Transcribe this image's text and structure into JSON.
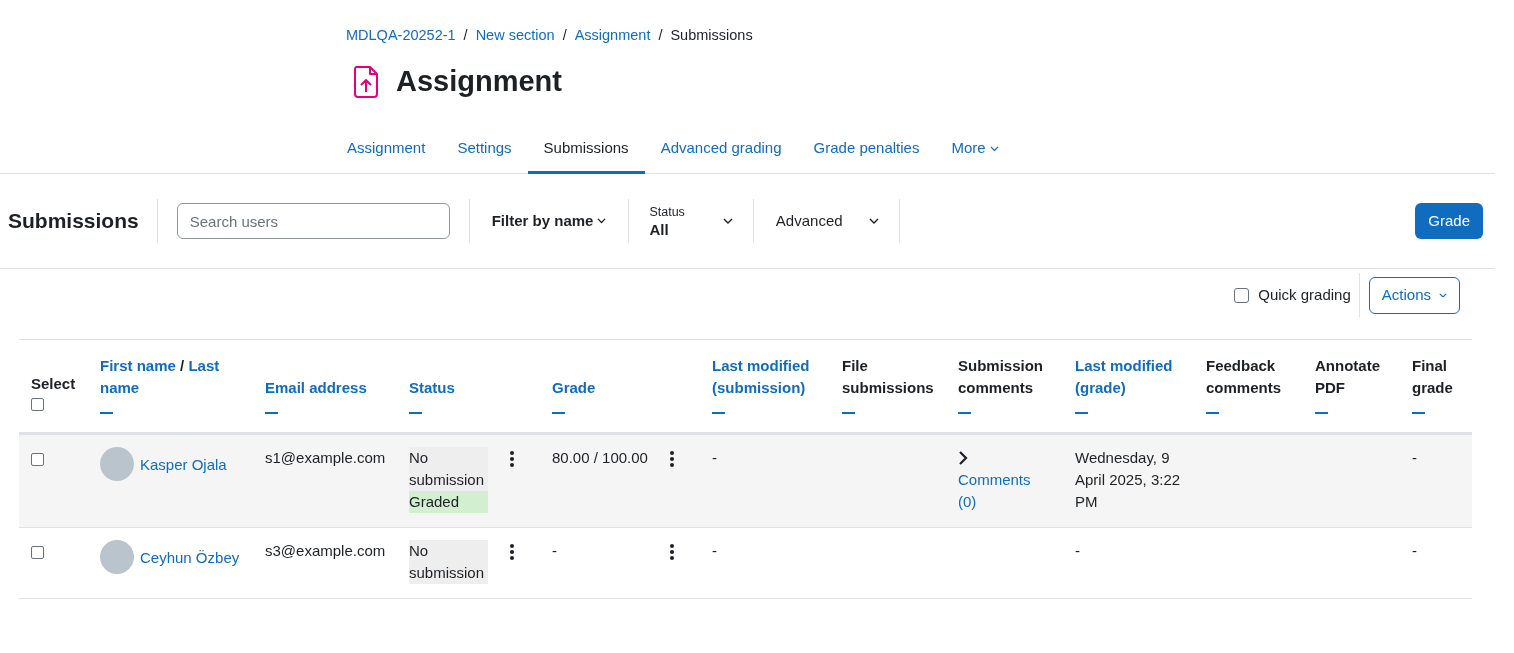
{
  "breadcrumb": [
    {
      "label": "MDLQA-20252-1",
      "link": true
    },
    {
      "separator": "/",
      "label": "New section",
      "link": true
    },
    {
      "separator": "/",
      "label": "Assignment",
      "link": true
    },
    {
      "separator": "/",
      "label": "Submissions",
      "link": false
    }
  ],
  "page_title": "Assignment",
  "tabs": [
    {
      "label": "Assignment",
      "selected": false,
      "kind": "tab"
    },
    {
      "label": "Settings",
      "selected": false,
      "kind": "tab"
    },
    {
      "label": "Submissions",
      "selected": true,
      "kind": "tab"
    },
    {
      "label": "Advanced grading",
      "selected": false,
      "kind": "tab"
    },
    {
      "label": "Grade penalties",
      "selected": false,
      "kind": "tab"
    },
    {
      "label": "More",
      "selected": false,
      "kind": "menu"
    }
  ],
  "toolbar": {
    "title": "Submissions",
    "search": {
      "placeholder": "Search users"
    },
    "filter_by_name": "Filter by name",
    "status": {
      "label": "Status",
      "value": "All"
    },
    "advanced": "Advanced",
    "grade_button": "Grade"
  },
  "quick_grading": {
    "label": "Quick grading",
    "checked": false
  },
  "actions_button": "Actions",
  "table": {
    "columns": [
      {
        "kind": "select",
        "label": "Select",
        "checked": false
      },
      {
        "kind": "name",
        "first": "First name",
        "separator": "/",
        "last": "Last name"
      },
      {
        "kind": "sort",
        "label": "Email address"
      },
      {
        "kind": "sort",
        "label": "Status"
      },
      {
        "kind": "sort",
        "label": "Grade"
      },
      {
        "kind": "sort",
        "label": "Last modified (submission)"
      },
      {
        "kind": "plain",
        "label": "File submissions"
      },
      {
        "kind": "plain",
        "label": "Submission comments"
      },
      {
        "kind": "sort",
        "label": "Last modified (grade)"
      },
      {
        "kind": "plain",
        "label": "Feedback comments"
      },
      {
        "kind": "plain",
        "label": "Annotate PDF"
      },
      {
        "kind": "plain",
        "label": "Final grade"
      }
    ],
    "rows": [
      {
        "selected": false,
        "name": "Kasper Ojala",
        "email": "s1@example.com",
        "status": [
          {
            "text": "No submission",
            "kind": "neutral"
          },
          {
            "text": "Graded",
            "kind": "success"
          }
        ],
        "grade": "80.00 / 100.00",
        "last_modified_submission": "-",
        "comments": {
          "expanded": false,
          "link": "Comments (0)"
        },
        "last_modified_grade": "Wednesday, 9 April 2025, 3:22 PM",
        "final_grade": "-"
      },
      {
        "selected": false,
        "name": "Ceyhun Özbey",
        "email": "s3@example.com",
        "status": [
          {
            "text": "No submission",
            "kind": "neutral"
          }
        ],
        "grade": "-",
        "last_modified_submission": "-",
        "last_modified_grade": "-",
        "final_grade": "-"
      }
    ]
  }
}
